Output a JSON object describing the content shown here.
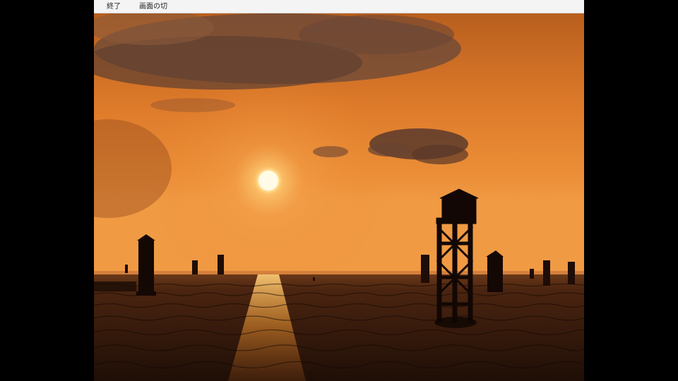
{
  "menu": {
    "items": [
      {
        "label": "終了"
      },
      {
        "label": "画面の切"
      }
    ]
  },
  "image": {
    "subject": "sunset-over-sea-with-pile-towers",
    "colors": {
      "sky_top": "#c96a22",
      "sky_mid": "#e8852e",
      "horizon": "#f0a04a",
      "sun": "#fff6c8",
      "water": "#2a1408",
      "silhouette": "#150905"
    }
  }
}
